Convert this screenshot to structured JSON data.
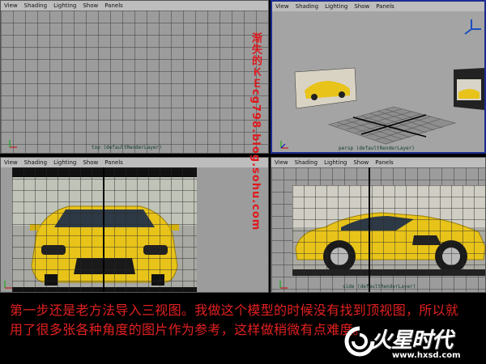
{
  "menu": [
    "View",
    "Shading",
    "Lighting",
    "Show",
    "Panels"
  ],
  "viewports": {
    "top": {
      "label": "top (defaultRenderLayer)"
    },
    "persp": {
      "label": "persp (defaultRenderLayer)"
    },
    "front": {
      "label": "front (defaultRenderLayer)"
    },
    "side": {
      "label": "side (defaultRenderLayer)"
    }
  },
  "watermark": "渐失的ＫＥcg798.blog.sohu.com",
  "caption": "第一步还是老方法导入三视图。我做这个模型的时候没有找到顶视图，所以就用了很多张各种角度的图片作为参考，这样做稍微有点难度。",
  "logo": {
    "name": "火星时代",
    "url": "www.hxsd.com"
  },
  "colors": {
    "viewport_bg": "#9c9c9c",
    "active_border": "#1c2c8f",
    "caption_text": "#e22020",
    "car_yellow": "#e8c319"
  }
}
